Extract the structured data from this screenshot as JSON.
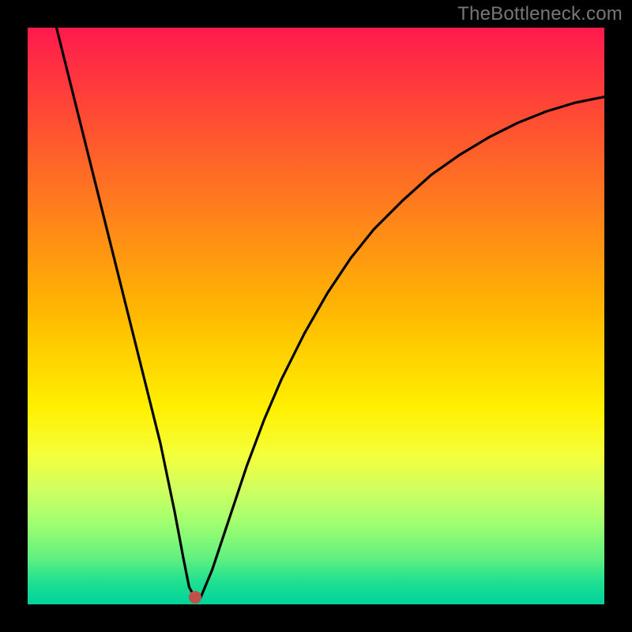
{
  "watermark": "TheBottleneck.com",
  "colors": {
    "frame": "#000000",
    "curve": "#000000",
    "marker": "#c05048",
    "gradient_top": "#ff1a4d",
    "gradient_bottom": "#00d29c"
  },
  "chart_data": {
    "type": "line",
    "title": "",
    "xlabel": "",
    "ylabel": "",
    "xlim": [
      0,
      100
    ],
    "ylim": [
      0,
      100
    ],
    "note": "Axes are unlabeled in the source image; values are read off as 0–100% of the plot area (x left→right, y bottom→up).",
    "series": [
      {
        "name": "curve",
        "x": [
          5,
          8,
          11,
          14,
          17,
          20,
          23,
          25.5,
          27,
          28,
          29,
          30,
          32,
          35,
          38,
          41,
          44,
          48,
          52,
          56,
          60,
          65,
          70,
          75,
          80,
          85,
          90,
          95,
          100
        ],
        "y": [
          100,
          88,
          76,
          64,
          52,
          40,
          28,
          16,
          8,
          3,
          1.2,
          1.2,
          6,
          15,
          24,
          32,
          39,
          47,
          54,
          60,
          65,
          70,
          74.5,
          78,
          81,
          83.5,
          85.5,
          87,
          88
        ]
      }
    ],
    "marker": {
      "x": 29,
      "y": 1.2
    },
    "annotations": []
  }
}
